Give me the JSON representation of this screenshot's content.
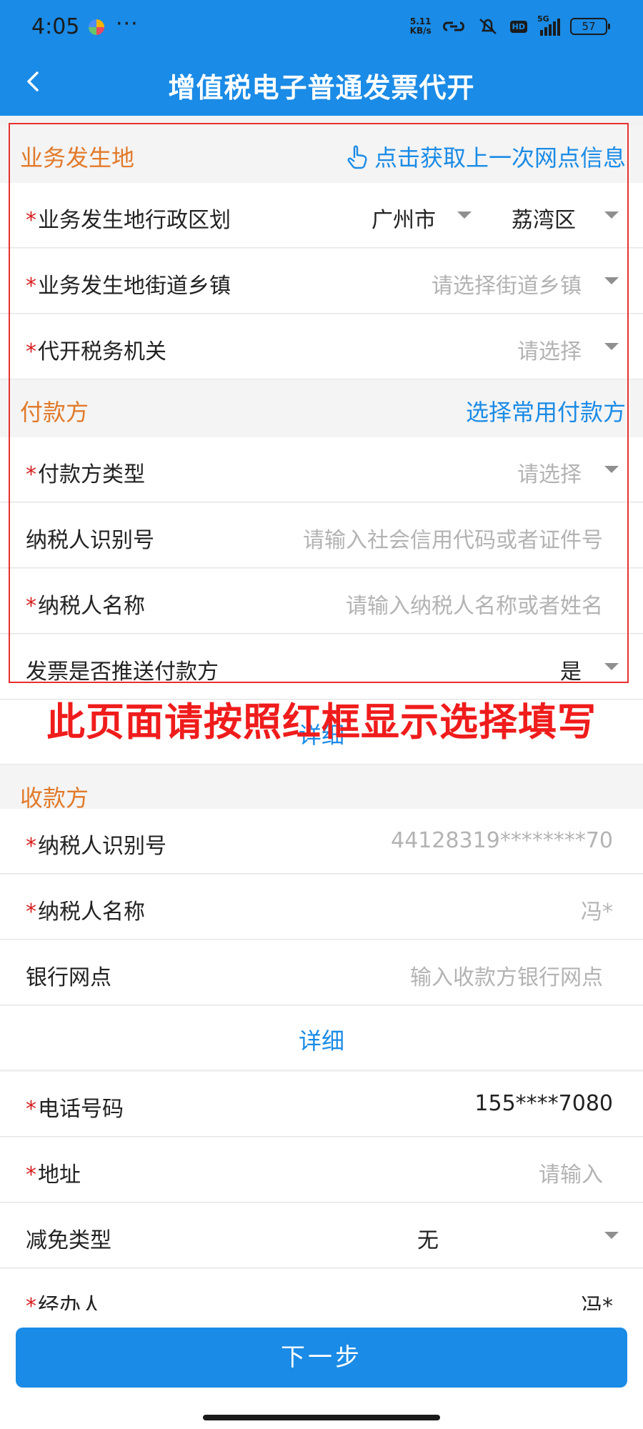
{
  "status_bar": {
    "time": "4:05",
    "dots": "···",
    "net_speed_top": "5.11",
    "net_speed_bottom": "KB/s",
    "hd": "HD",
    "network": "5G",
    "battery": "57"
  },
  "header": {
    "title": "增值税电子普通发票代开",
    "back_icon": "chevron-left-icon"
  },
  "business_location": {
    "section_label": "业务发生地",
    "action_label": "点击获取上一次网点信息",
    "action_icon": "hand-pointer-icon",
    "rows": [
      {
        "label": "业务发生地行政区划",
        "required": "*",
        "city": "广州市",
        "district": "荔湾区"
      },
      {
        "label": "业务发生地街道乡镇",
        "required": "*",
        "placeholder": "请选择街道乡镇"
      },
      {
        "label": "代开税务机关",
        "required": "*",
        "placeholder": "请选择"
      }
    ]
  },
  "payer": {
    "section_label": "付款方",
    "action_label": "选择常用付款方",
    "rows": [
      {
        "label": "付款方类型",
        "required": "*",
        "placeholder": "请选择"
      },
      {
        "label": "纳税人识别号",
        "placeholder": "请输入社会信用代码或者证件号"
      },
      {
        "label": "纳税人名称",
        "required": "*",
        "placeholder": "请输入纳税人名称或者姓名"
      },
      {
        "label": "发票是否推送付款方",
        "value": "是"
      }
    ],
    "detail_link": "详细"
  },
  "overlay_note": "此页面请按照红框显示选择填写",
  "payee": {
    "section_label": "收款方",
    "rows": [
      {
        "label": "纳税人识别号",
        "required": "*",
        "value": "44128319********70"
      },
      {
        "label": "纳税人名称",
        "required": "*",
        "value": "冯*"
      },
      {
        "label": "银行网点",
        "placeholder": "输入收款方银行网点"
      }
    ],
    "detail_link": "详细"
  },
  "contact": {
    "rows": [
      {
        "label": "电话号码",
        "required": "*",
        "value": "155****7080"
      },
      {
        "label": "地址",
        "required": "*",
        "placeholder": "请输入"
      },
      {
        "label": "减免类型",
        "value": "无"
      },
      {
        "label": "经办人",
        "required": "*",
        "value": "冯*"
      }
    ]
  },
  "footer": {
    "next_button": "下一步"
  },
  "colors": {
    "primary": "#1a8be6",
    "section_label": "#e27a2a",
    "required_mark": "#d62020",
    "highlight_border": "#e83030"
  }
}
